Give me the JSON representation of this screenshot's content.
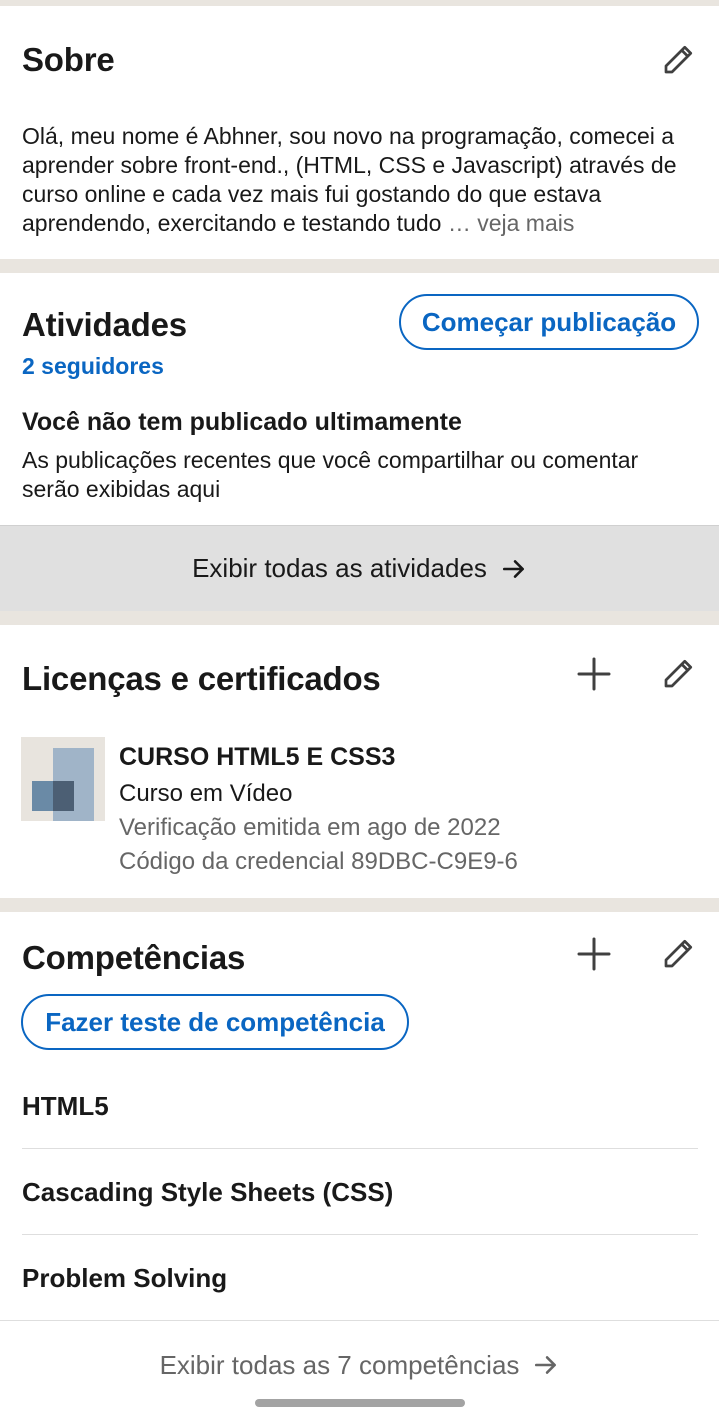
{
  "about": {
    "title": "Sobre",
    "text": "Olá, meu nome é Abhner, sou novo na programação, comecei a aprender sobre front-end., (HTML, CSS e Javascript) através de curso online e cada vez mais fui gostando do que estava aprendendo, exercitando e testando tudo",
    "ellipsis": "…",
    "more_label": "veja mais",
    "edit_icon": "pencil-icon"
  },
  "activity": {
    "title": "Atividades",
    "followers": "2 seguidores",
    "start_post_label": "Começar publicação",
    "empty_title": "Você não tem publicado ultimamente",
    "empty_text": "As publicações recentes que você compartilhar ou comentar serão exibidas aqui",
    "show_all_label": "Exibir todas as atividades",
    "arrow_icon": "arrow-right-icon"
  },
  "licenses": {
    "title": "Licenças e certificados",
    "add_icon": "plus-icon",
    "edit_icon": "pencil-icon",
    "items": [
      {
        "name": "CURSO HTML5 E CSS3",
        "issuer": "Curso em Vídeo",
        "issued": "Verificação emitida em ago de 2022",
        "credential": "Código da credencial 89DBC-C9E9-6"
      }
    ]
  },
  "skills": {
    "title": "Competências",
    "add_icon": "plus-icon",
    "edit_icon": "pencil-icon",
    "test_label": "Fazer teste de competência",
    "items": [
      "HTML5",
      "Cascading Style Sheets (CSS)",
      "Problem Solving"
    ],
    "show_all_label": "Exibir todas as 7 competências",
    "arrow_icon": "arrow-right-icon"
  },
  "colors": {
    "brand_blue": "#0a66c2",
    "page_bg": "#e9e5df",
    "text": "#191919",
    "muted": "#666666"
  }
}
